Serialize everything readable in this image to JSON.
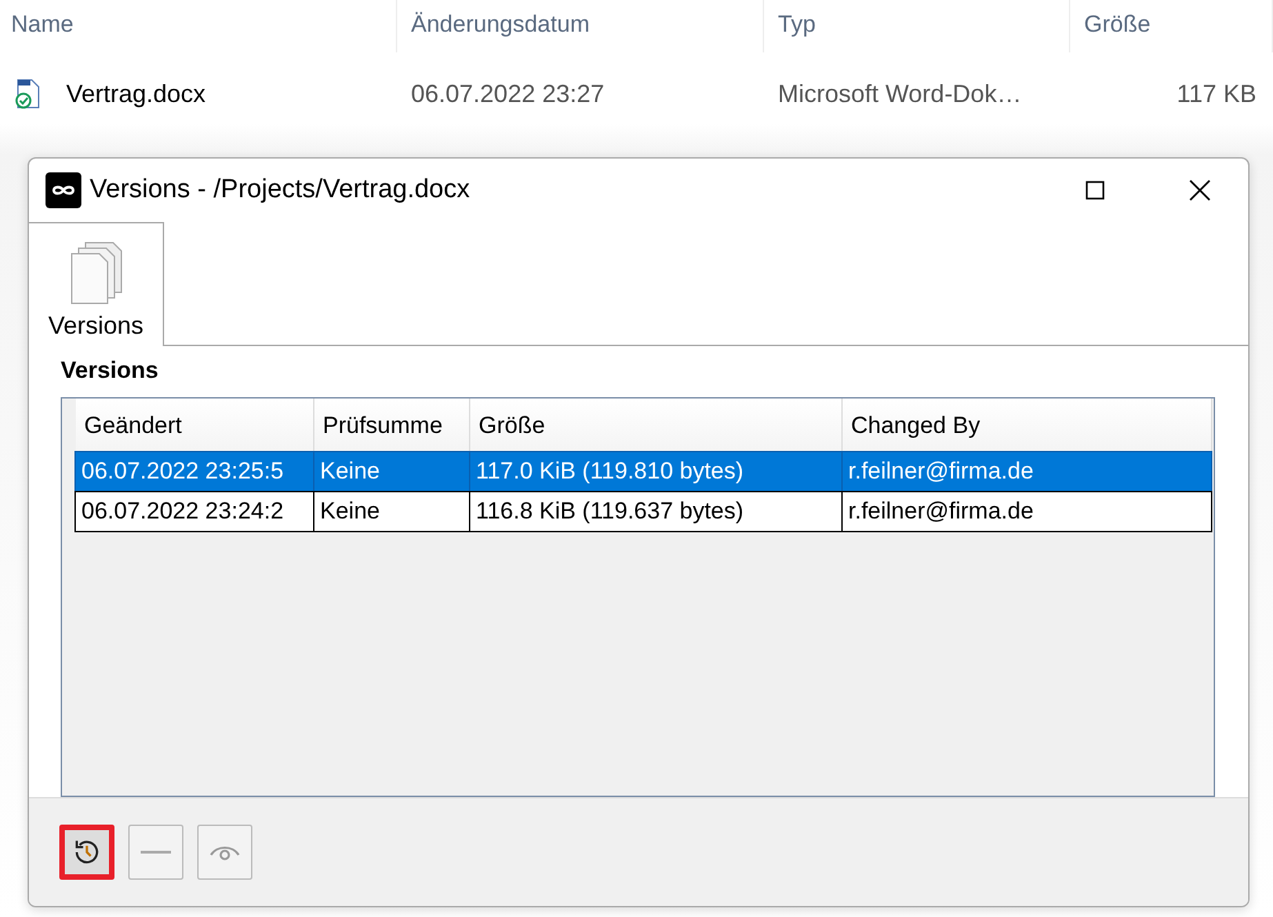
{
  "explorer": {
    "columns": [
      "Name",
      "Änderungsdatum",
      "Typ",
      "Größe"
    ],
    "rows": [
      {
        "name": "Vertrag.docx",
        "modified": "06.07.2022 23:27",
        "type": "Microsoft Word-Dok…",
        "size": "117 KB"
      }
    ]
  },
  "dialog": {
    "title": "Versions - /Projects/Vertrag.docx",
    "tabs": [
      {
        "label": "Versions",
        "selected": true
      }
    ],
    "section_title": "Versions",
    "table": {
      "columns": [
        "Geändert",
        "Prüfsumme",
        "Größe",
        "Changed By"
      ],
      "rows": [
        {
          "selected": true,
          "cells": [
            "06.07.2022 23:25:5",
            "Keine",
            "117.0 KiB (119.810 bytes)",
            "r.feilner@firma.de"
          ]
        },
        {
          "selected": false,
          "cells": [
            "06.07.2022 23:24:2",
            "Keine",
            "116.8 KiB (119.637 bytes)",
            "r.feilner@firma.de"
          ]
        }
      ]
    },
    "buttons": [
      {
        "kind": "restore",
        "highlighted": true,
        "disabled": false
      },
      {
        "kind": "remove",
        "highlighted": false,
        "disabled": true
      },
      {
        "kind": "view",
        "highlighted": false,
        "disabled": true
      }
    ]
  }
}
